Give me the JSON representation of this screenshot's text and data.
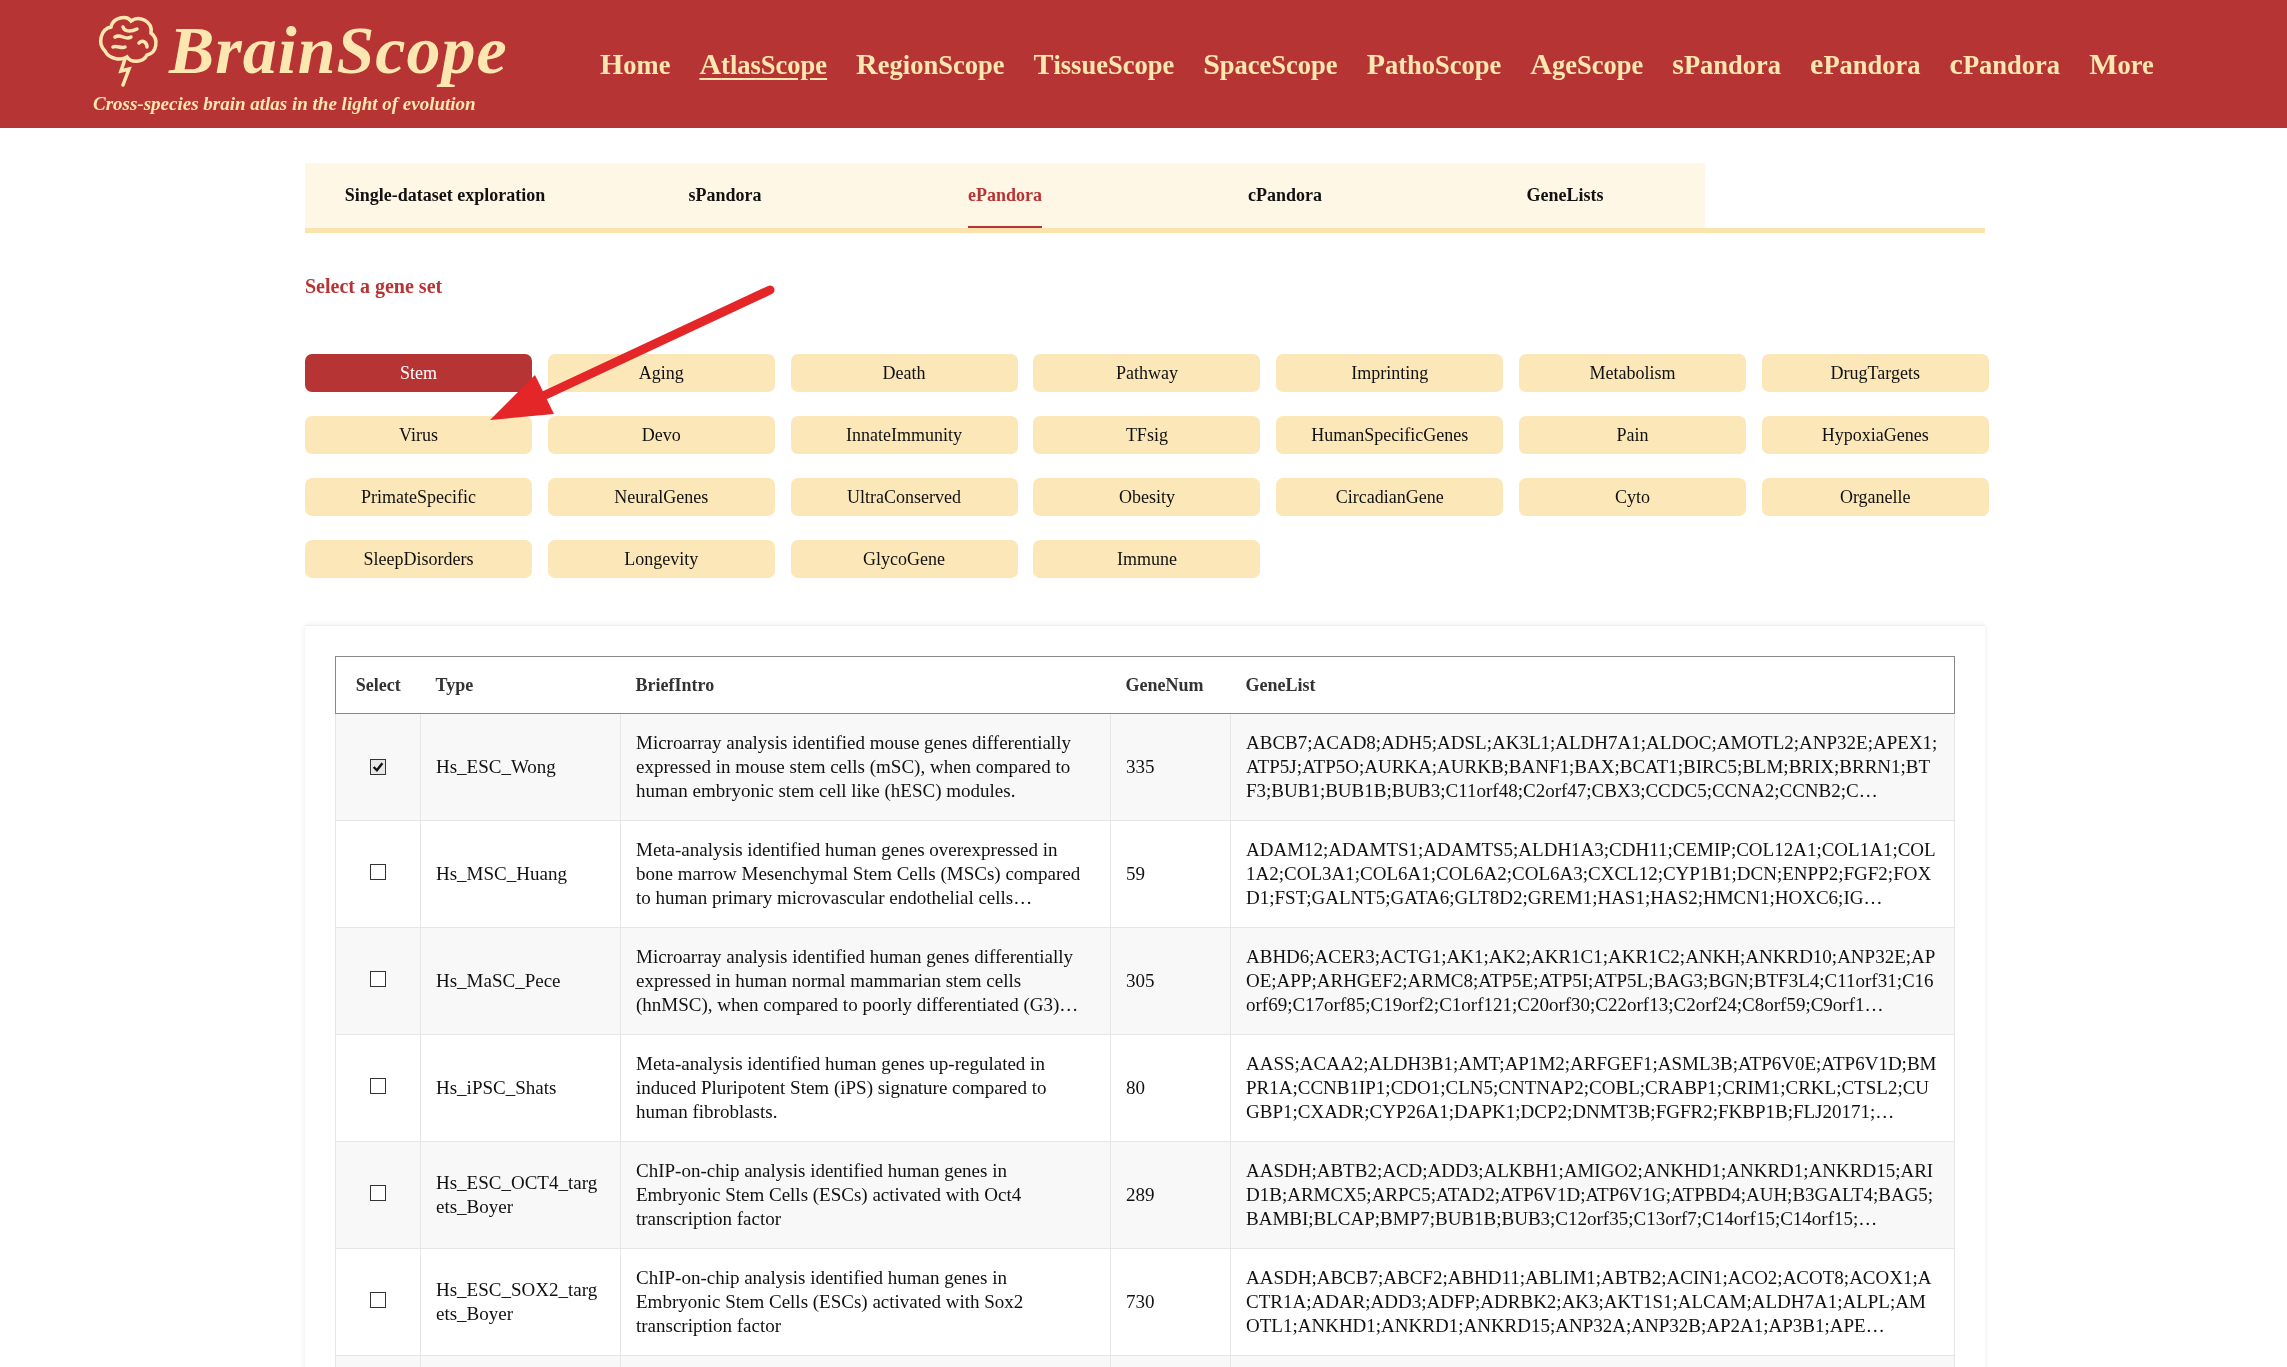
{
  "header": {
    "logo": "BrainScope",
    "tagline": "Cross-species brain atlas in the light of evolution",
    "nav": [
      {
        "label": "Home",
        "selected": false
      },
      {
        "label": "AtlasScope",
        "selected": true
      },
      {
        "label": "RegionScope",
        "selected": false
      },
      {
        "label": "TissueScope",
        "selected": false
      },
      {
        "label": "SpaceScope",
        "selected": false
      },
      {
        "label": "PathoScope",
        "selected": false
      },
      {
        "label": "AgeScope",
        "selected": false
      },
      {
        "label": "sPandora",
        "selected": false
      },
      {
        "label": "ePandora",
        "selected": false
      },
      {
        "label": "cPandora",
        "selected": false
      },
      {
        "label": "More",
        "selected": false
      }
    ]
  },
  "tabs": [
    {
      "label": "Single-dataset exploration",
      "selected": false
    },
    {
      "label": "sPandora",
      "selected": false
    },
    {
      "label": "ePandora",
      "selected": true
    },
    {
      "label": "cPandora",
      "selected": false
    },
    {
      "label": "GeneLists",
      "selected": false
    }
  ],
  "gene_set_heading": "Select a gene set",
  "gene_sets": [
    {
      "label": "Stem",
      "selected": true
    },
    {
      "label": "Aging",
      "selected": false
    },
    {
      "label": "Death",
      "selected": false
    },
    {
      "label": "Pathway",
      "selected": false
    },
    {
      "label": "Imprinting",
      "selected": false
    },
    {
      "label": "Metabolism",
      "selected": false
    },
    {
      "label": "DrugTargets",
      "selected": false
    },
    {
      "label": "Virus",
      "selected": false
    },
    {
      "label": "Devo",
      "selected": false
    },
    {
      "label": "InnateImmunity",
      "selected": false
    },
    {
      "label": "TFsig",
      "selected": false
    },
    {
      "label": "HumanSpecificGenes",
      "selected": false
    },
    {
      "label": "Pain",
      "selected": false
    },
    {
      "label": "HypoxiaGenes",
      "selected": false
    },
    {
      "label": "PrimateSpecific",
      "selected": false
    },
    {
      "label": "NeuralGenes",
      "selected": false
    },
    {
      "label": "UltraConserved",
      "selected": false
    },
    {
      "label": "Obesity",
      "selected": false
    },
    {
      "label": "CircadianGene",
      "selected": false
    },
    {
      "label": "Cyto",
      "selected": false
    },
    {
      "label": "Organelle",
      "selected": false
    },
    {
      "label": "SleepDisorders",
      "selected": false
    },
    {
      "label": "Longevity",
      "selected": false
    },
    {
      "label": "GlycoGene",
      "selected": false
    },
    {
      "label": "Immune",
      "selected": false
    }
  ],
  "table": {
    "columns": [
      "Select",
      "Type",
      "BriefIntro",
      "GeneNum",
      "GeneList"
    ],
    "rows": [
      {
        "selected": true,
        "type": "Hs_ESC_Wong",
        "intro": "Microarray analysis identified mouse genes differentially expressed in mouse stem cells (mSC), when compared to human embryonic stem cell like (hESC) modules.",
        "gene_num": "335",
        "gene_list": "ABCB7;ACAD8;ADH5;ADSL;AK3L1;ALDH7A1;ALDOC;AMOTL2;ANP32E;APEX1;ATP5J;ATP5O;AURKA;AURKB;BANF1;BAX;BCAT1;BIRC5;BLM;BRIX;BRRN1;BTF3;BUB1;BUB1B;BUB3;C11orf48;C2orf47;CBX3;CCDC5;CCNA2;CCNB2;C…"
      },
      {
        "selected": false,
        "type": "Hs_MSC_Huang",
        "intro": "Meta-analysis identified human genes overexpressed in bone marrow Mesenchymal Stem Cells (MSCs) compared to human primary microvascular endothelial cells…",
        "gene_num": "59",
        "gene_list": "ADAM12;ADAMTS1;ADAMTS5;ALDH1A3;CDH11;CEMIP;COL12A1;COL1A1;COL1A2;COL3A1;COL6A1;COL6A2;COL6A3;CXCL12;CYP1B1;DCN;ENPP2;FGF2;FOXD1;FST;GALNT5;GATA6;GLT8D2;GREM1;HAS1;HAS2;HMCN1;HOXC6;IG…"
      },
      {
        "selected": false,
        "type": "Hs_MaSC_Pece",
        "intro": "Microarray analysis identified human genes differentially expressed in human normal mammarian stem cells (hnMSC), when compared to poorly differentiated (G3)…",
        "gene_num": "305",
        "gene_list": "ABHD6;ACER3;ACTG1;AK1;AK2;AKR1C1;AKR1C2;ANKH;ANKRD10;ANP32E;APOE;APP;ARHGEF2;ARMC8;ATP5E;ATP5I;ATP5L;BAG3;BGN;BTF3L4;C11orf31;C16orf69;C17orf85;C19orf2;C1orf121;C20orf30;C22orf13;C2orf24;C8orf59;C9orf1…"
      },
      {
        "selected": false,
        "type": "Hs_iPSC_Shats",
        "intro": "Meta-analysis identified human genes up-regulated in induced Pluripotent Stem (iPS) signature compared to human fibroblasts.",
        "gene_num": "80",
        "gene_list": "AASS;ACAA2;ALDH3B1;AMT;AP1M2;ARFGEF1;ASML3B;ATP6V0E;ATP6V1D;BMPR1A;CCNB1IP1;CDO1;CLN5;CNTNAP2;COBL;CRABP1;CRIM1;CRKL;CTSL2;CUGBP1;CXADR;CYP26A1;DAPK1;DCP2;DNMT3B;FGFR2;FKBP1B;FLJ20171;…"
      },
      {
        "selected": false,
        "type": "Hs_ESC_OCT4_targets_Boyer",
        "intro": "ChIP-on-chip analysis identified human genes in Embryonic Stem Cells (ESCs) activated with Oct4 transcription factor",
        "gene_num": "289",
        "gene_list": "AASDH;ABTB2;ACD;ADD3;ALKBH1;AMIGO2;ANKHD1;ANKRD1;ANKRD15;ARID1B;ARMCX5;ARPC5;ATAD2;ATP6V1D;ATP6V1G;ATPBD4;AUH;B3GALT4;BAG5;BAMBI;BLCAP;BMP7;BUB1B;BUB3;C12orf35;C13orf7;C14orf15;C14orf15;…"
      },
      {
        "selected": false,
        "type": "Hs_ESC_SOX2_targets_Boyer",
        "intro": "ChIP-on-chip analysis identified human genes in Embryonic Stem Cells (ESCs) activated with Sox2 transcription factor",
        "gene_num": "730",
        "gene_list": "AASDH;ABCB7;ABCF2;ABHD11;ABLIM1;ABTB2;ACIN1;ACO2;ACOT8;ACOX1;ACTR1A;ADAR;ADD3;ADFP;ADRBK2;AK3;AKT1S1;ALCAM;ALDH7A1;ALPL;AMOTL1;ANKHD1;ANKRD1;ANKRD15;ANP32A;ANP32B;AP2A1;AP3B1;APE…"
      }
    ]
  }
}
